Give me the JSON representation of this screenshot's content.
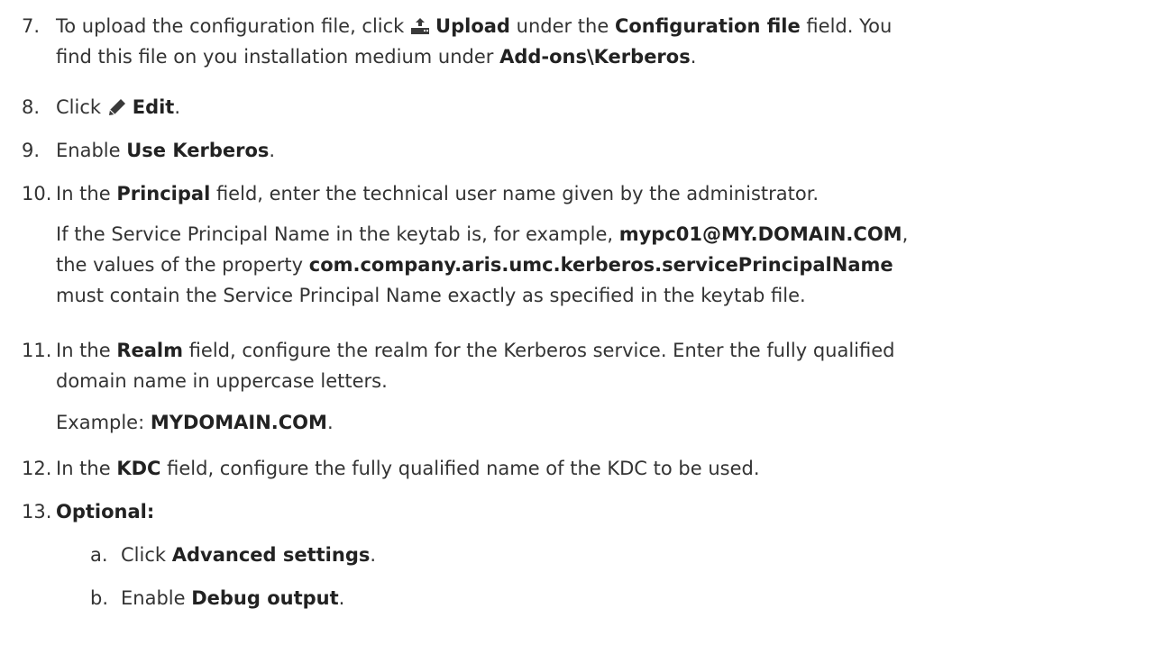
{
  "steps": {
    "s7": {
      "num": "7.",
      "t1": "To upload the configuration file, click ",
      "b1": "Upload",
      "t2": " under the ",
      "b2": "Configuration file",
      "t3": " field. You",
      "l2_t1": "find this file on you installation medium under ",
      "l2_b1": "Add-ons\\Kerberos",
      "l2_t2": "."
    },
    "s8": {
      "num": "8.",
      "t1": "Click ",
      "b1": "Edit",
      "t2": "."
    },
    "s9": {
      "num": "9.",
      "t1": "Enable ",
      "b1": "Use Kerberos",
      "t2": "."
    },
    "s10": {
      "num": "10.",
      "t1": "In the ",
      "b1": "Principal",
      "t2": " field, enter the technical user name given by the administrator.",
      "p1_t1": "If the Service Principal Name in the keytab is, for example, ",
      "p1_b1": "mypc01@MY.DOMAIN.COM",
      "p1_t2": ",",
      "p2_t1": "the values of the property ",
      "p2_b1": "com.company.aris.umc.kerberos.servicePrincipalName",
      "p3_t1": "must contain the Service Principal Name exactly as specified in the keytab file."
    },
    "s11": {
      "num": "11.",
      "t1": "In the ",
      "b1": "Realm",
      "t2": " field, configure the realm for the Kerberos service. Enter the fully qualified",
      "l2": "domain name in uppercase letters.",
      "ex_t1": "Example: ",
      "ex_b1": "MYDOMAIN.COM",
      "ex_t2": "."
    },
    "s12": {
      "num": "12.",
      "t1": "In the ",
      "b1": "KDC",
      "t2": " field, configure the fully qualified name of the KDC to be used."
    },
    "s13": {
      "num": "13.",
      "b1": "Optional:",
      "a": {
        "num": "a.",
        "t1": "Click ",
        "b1": "Advanced settings",
        "t2": "."
      },
      "b": {
        "num": "b.",
        "t1": "Enable ",
        "b1": "Debug output",
        "t2": "."
      }
    }
  },
  "icons": {
    "upload": "upload-icon",
    "edit": "pencil-icon"
  },
  "colors": {
    "text": "#333333",
    "bold": "#222222"
  }
}
